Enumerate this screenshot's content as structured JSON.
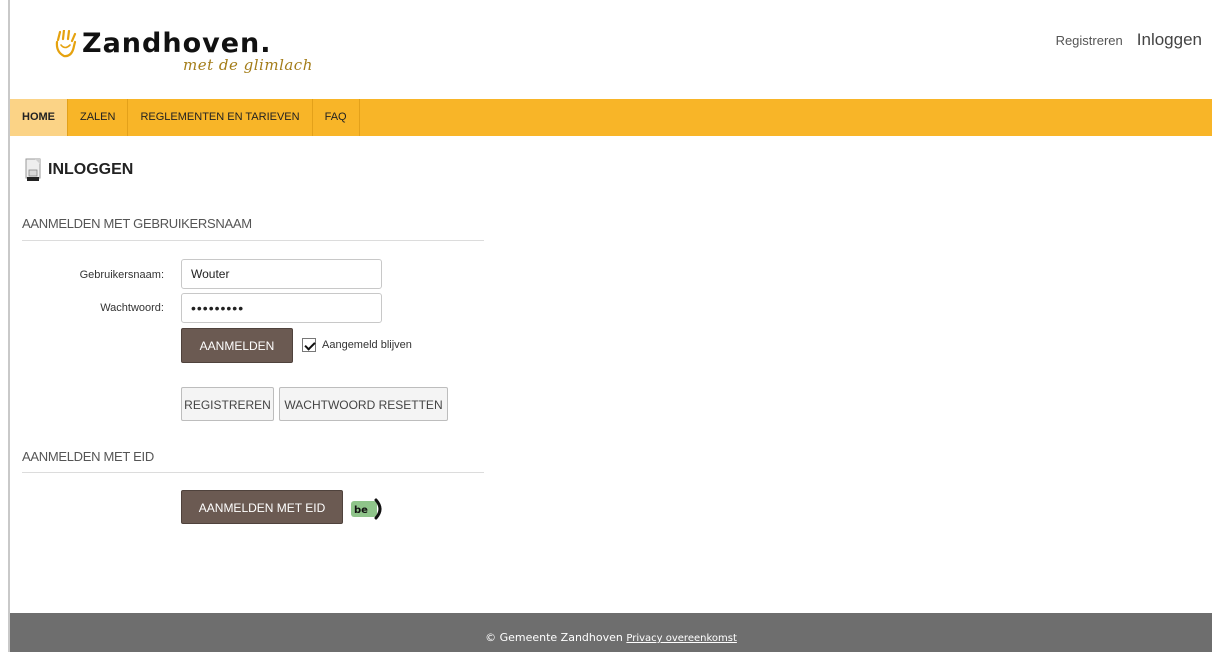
{
  "header": {
    "logo_word": "Zandhoven.",
    "logo_tagline": "met de glimlach",
    "register_link": "Registreren",
    "login_link": "Inloggen"
  },
  "nav": {
    "items": [
      {
        "label": "HOME",
        "active": true
      },
      {
        "label": "ZALEN",
        "active": false
      },
      {
        "label": "REGLEMENTEN EN TARIEVEN",
        "active": false
      },
      {
        "label": "FAQ",
        "active": false
      }
    ]
  },
  "page": {
    "title": "INLOGGEN",
    "title_icon": "login-door-icon"
  },
  "username_section": {
    "title": "AANMELDEN MET GEBRUIKERSNAAM",
    "username_label": "Gebruikersnaam:",
    "username_value": "Wouter",
    "password_label": "Wachtwoord:",
    "password_value": "•••••••••",
    "login_button": "AANMELDEN",
    "remember_label": "Aangemeld blijven",
    "remember_checked": true,
    "register_button": "REGISTREREN",
    "reset_button": "WACHTWOORD RESETTEN"
  },
  "eid_section": {
    "title": "AANMELDEN MET EID",
    "eid_button": "AANMELDEN MET EID",
    "eid_logo_text": "be"
  },
  "footer": {
    "copyright": "© Gemeente Zandhoven",
    "privacy_link": "Privacy overeenkomst"
  },
  "colors": {
    "nav_bg": "#f8b528",
    "nav_active": "#fbd386",
    "button_dark": "#6b5a52",
    "footer_bg": "#6e6e6e",
    "tagline": "#a47d19"
  }
}
